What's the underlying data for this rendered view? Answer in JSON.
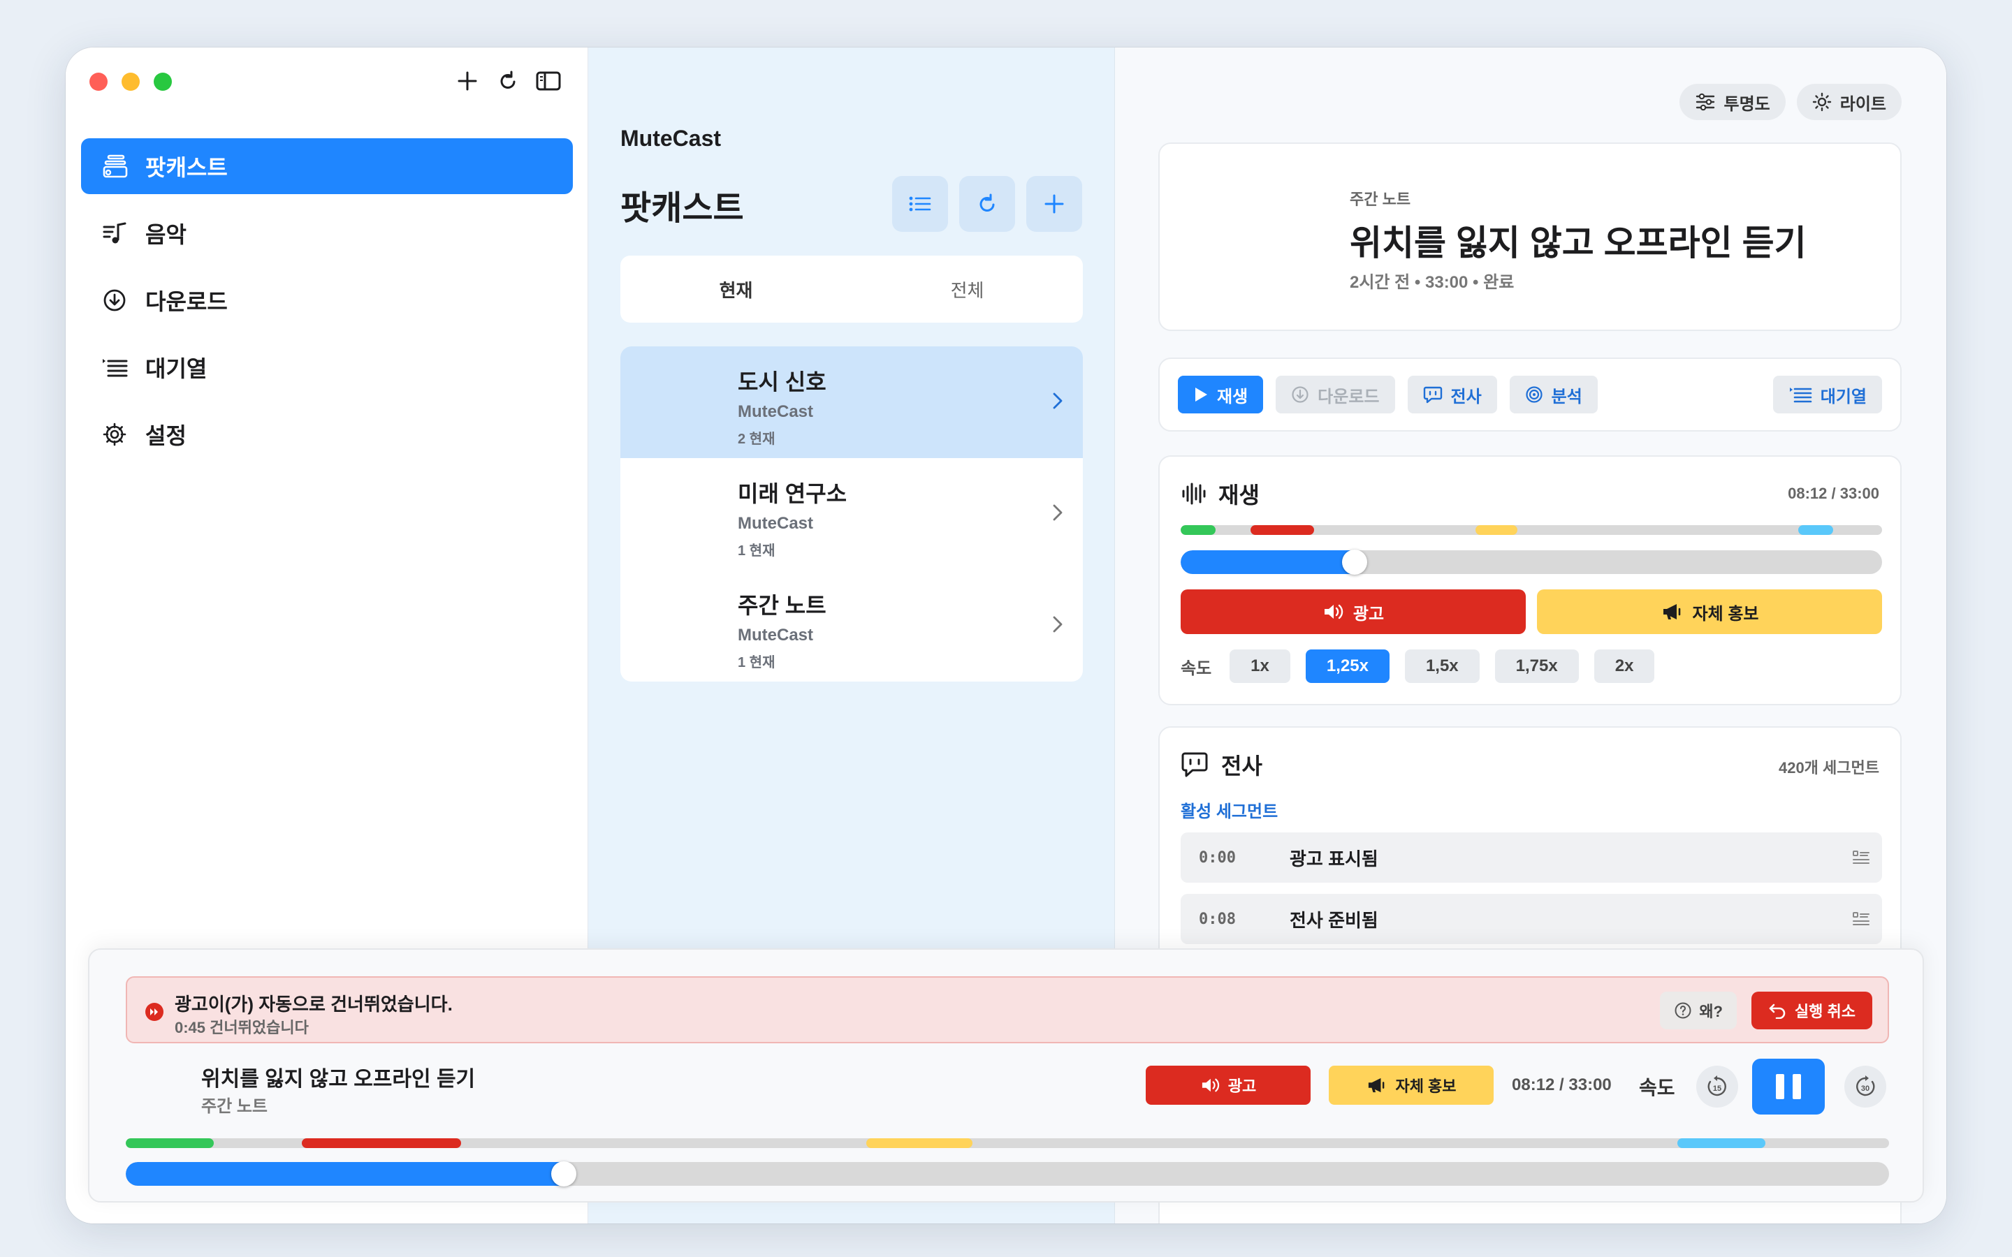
{
  "sidebar": {
    "items": [
      {
        "label": "팟캐스트",
        "icon": "podcast-stack-icon",
        "active": true
      },
      {
        "label": "음악",
        "icon": "music-list-icon",
        "active": false
      },
      {
        "label": "다운로드",
        "icon": "download-circle-icon",
        "active": false
      },
      {
        "label": "대기열",
        "icon": "queue-list-icon",
        "active": false
      },
      {
        "label": "설정",
        "icon": "gear-icon",
        "active": false
      }
    ]
  },
  "list": {
    "app_name": "MuteCast",
    "title": "팟캐스트",
    "tabs": [
      "현재",
      "전체"
    ],
    "podcasts": [
      {
        "title": "도시 신호",
        "source": "MuteCast",
        "count": "2 현재"
      },
      {
        "title": "미래 연구소",
        "source": "MuteCast",
        "count": "1 현재"
      },
      {
        "title": "주간 노트",
        "source": "MuteCast",
        "count": "1 현재"
      }
    ]
  },
  "detail": {
    "opacity_label": "투명도",
    "theme_label": "라이트",
    "episode": {
      "show": "주간 노트",
      "title": "위치를 잃지 않고 오프라인 듣기",
      "meta": "2시간 전 • 33:00 • 완료"
    },
    "actions": {
      "play": "재생",
      "download": "다운로드",
      "transcript": "전사",
      "analysis": "분석",
      "queue": "대기열"
    },
    "playback": {
      "title": "재생",
      "time": "08:12 / 33:00",
      "progress": 0.2485,
      "ad_label": "광고",
      "promo_label": "자체 홍보",
      "speed_label": "속도",
      "speeds": [
        "1x",
        "1,25x",
        "1,5x",
        "1,75x",
        "2x"
      ],
      "active_speed": "1,25x",
      "segments": [
        {
          "kind": "intro",
          "start": 0.0,
          "end": 0.05,
          "color": "#34c759"
        },
        {
          "kind": "ad",
          "start": 0.1,
          "end": 0.19,
          "color": "#dc2b20"
        },
        {
          "kind": "promo",
          "start": 0.42,
          "end": 0.48,
          "color": "#ffd35a"
        },
        {
          "kind": "outro",
          "start": 0.88,
          "end": 0.93,
          "color": "#5ac8fa"
        }
      ]
    },
    "transcript": {
      "title": "전사",
      "segment_count": "420개 세그먼트",
      "active_label": "활성 세그먼트",
      "rows": [
        {
          "time": "0:00",
          "text": "광고 표시됨"
        },
        {
          "time": "0:08",
          "text": "전사 준비됨"
        }
      ]
    }
  },
  "mini": {
    "toast_title": "광고이(가) 자동으로 건너뛰었습니다.",
    "toast_sub": "0:45 건너뛰었습니다",
    "why_label": "왜?",
    "undo_label": "실행 취소",
    "title": "위치를 잃지 않고 오프라인 듣기",
    "show": "주간 노트",
    "ad_label": "광고",
    "promo_label": "자체 홍보",
    "time": "08:12 / 33:00",
    "speed_label": "속도",
    "skip_back": "15",
    "skip_forward": "30"
  },
  "colors": {
    "accent": "#1f86ff",
    "ad": "#dc2b20",
    "promo": "#ffd35a",
    "sidebar_active": "#1f86ff",
    "list_bg": "#e8f3fc"
  }
}
